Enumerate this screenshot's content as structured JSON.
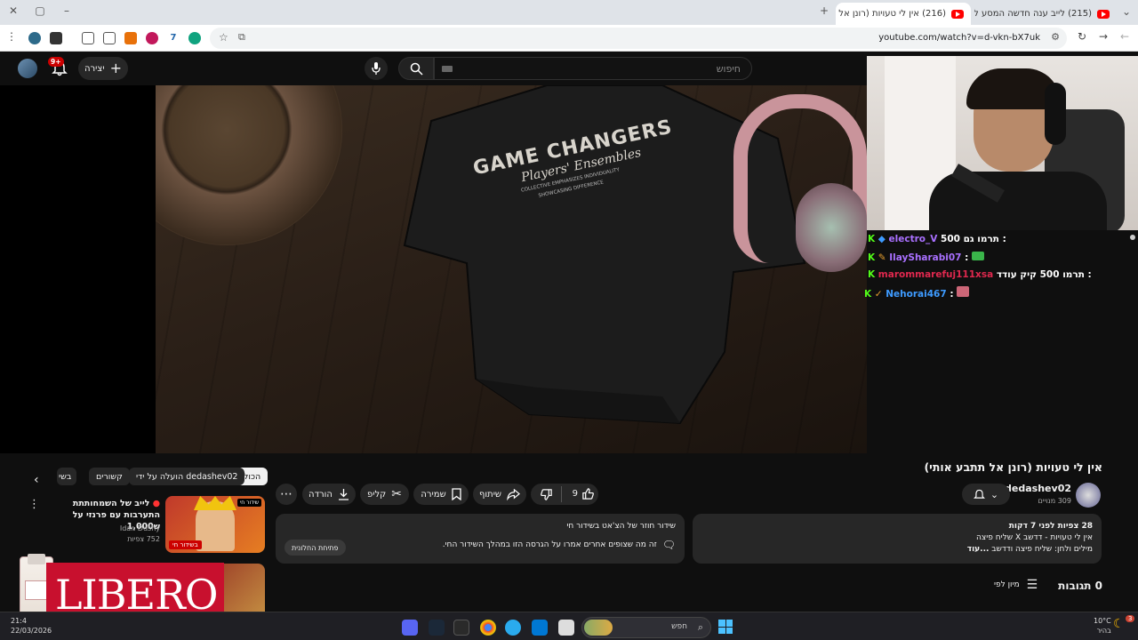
{
  "browser": {
    "tabs": [
      {
        "title": "(215) לייב ענה חדשה המסע ל...",
        "active": false
      },
      {
        "title": "(216) אין לי טעויות (רונן אל תתב...",
        "active": true
      }
    ],
    "new_tab": "+",
    "url": "youtube.com/watch?v=d-vkn-bX7uk"
  },
  "youtube": {
    "search_placeholder": "חיפוש",
    "create_label": "יצירה",
    "notifications_badge": "9+"
  },
  "video": {
    "shirt_text_main": "GAME CHANGERS",
    "shirt_text_sub": "Players' Ensembles",
    "shirt_text_small1": "COLLECTIVE EMPHASIZES INDIVIDUALITY",
    "shirt_text_small2": "SHOWCASING DIFFERENCE",
    "chat": [
      {
        "user": "electro_V",
        "text": "תרמו גם 500 :",
        "color": "#a970ff"
      },
      {
        "user": "IlaySharabi07",
        "text": ":",
        "color": "#a970ff"
      },
      {
        "user": "marommarefuj111xsa",
        "text": "תרמו 500 קיק עודד :",
        "color": "#e0284e"
      },
      {
        "user": "Nehorai467",
        "text": ":",
        "color": "#3e9bff"
      }
    ]
  },
  "watch": {
    "title": "אין לי טעויות (רונן אל תתבע אותי)",
    "channel": "dedashev02",
    "subscribers": "309 מנויים",
    "likes": "9",
    "share_label": "שיתוף",
    "save_label": "שמירה",
    "clip_label": "קליפ",
    "download_label": "הורדה",
    "description": {
      "stats": "28 צפיות  לפני 7 דקות",
      "line1": "אין לי טעויות - דדשב X שליח פיצה",
      "line2": "מילים ולחן: שליח פיצה ודדשב",
      "more": "...עוד"
    },
    "live_chat_card": {
      "heading": "שידור חוזר של הצ'אט בשידור חי",
      "body": "זה מה שצופים אחרים אמרו על הגרסה הזו במהלך השידור החי.",
      "button": "פתיחת החלונית"
    },
    "comments_count": "0 תגובות",
    "sort_label": "מיון לפי"
  },
  "chips": [
    "הכול",
    "הועלה על ידי dedashev02",
    "קשורים",
    "בשי"
  ],
  "recommendations": [
    {
      "title_line1": "לייב של השמחותתת",
      "title_line2": "התערבות עם פרנזי על ש1,000",
      "channel": "Idan Dushy",
      "views": "752 צפיות",
      "badge": "בשידור חי",
      "thumb_label": "שידור חי"
    }
  ],
  "overlay_logo": "LIBERO",
  "taskbar": {
    "search_placeholder": "חפש",
    "time": "21:4",
    "date": "22/03/2026",
    "weather": "10°C",
    "weather_desc": "בהיר",
    "badge": "3"
  }
}
